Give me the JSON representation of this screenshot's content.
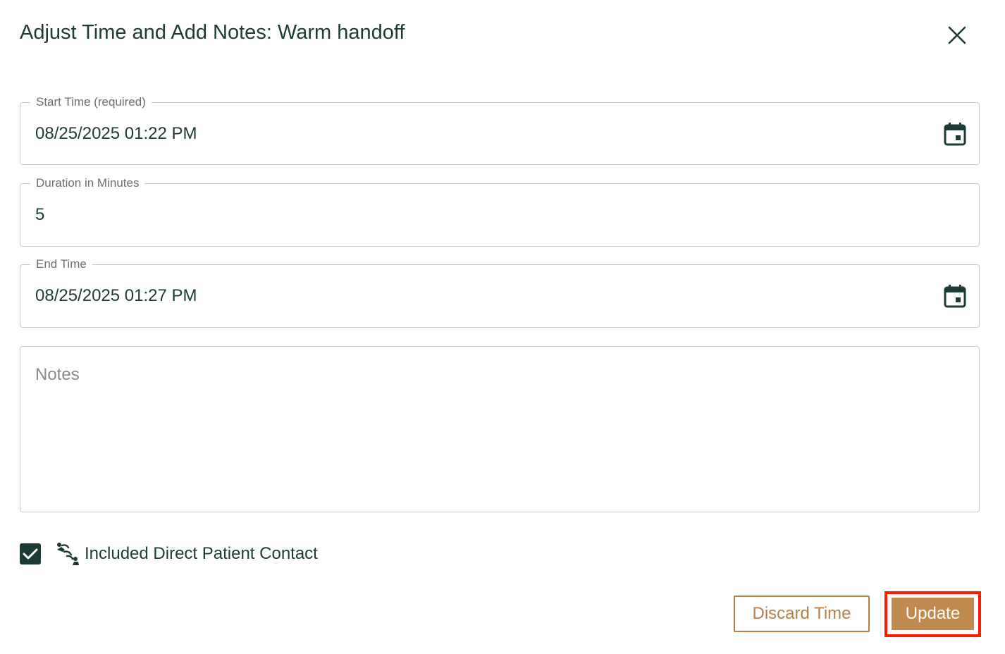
{
  "dialog": {
    "title": "Adjust Time and Add Notes: Warm handoff",
    "close_icon": "close-icon"
  },
  "start_time": {
    "label": "Start Time (required)",
    "value": "08/25/2025 01:22 PM",
    "icon": "calendar-icon"
  },
  "duration": {
    "label": "Duration in Minutes",
    "value": "5"
  },
  "end_time": {
    "label": "End Time",
    "value": "08/25/2025 01:27 PM",
    "icon": "calendar-icon"
  },
  "notes": {
    "placeholder": "Notes",
    "value": ""
  },
  "direct_contact": {
    "checked": true,
    "icon": "patient-contact-icon",
    "label": "Included Direct Patient Contact"
  },
  "actions": {
    "discard_label": "Discard Time",
    "update_label": "Update"
  },
  "colors": {
    "primary_text": "#1c3b37",
    "accent": "#c08a4f",
    "accent_outline": "#b97f45",
    "highlight": "#ff1a00",
    "border": "#c9c9c9"
  }
}
